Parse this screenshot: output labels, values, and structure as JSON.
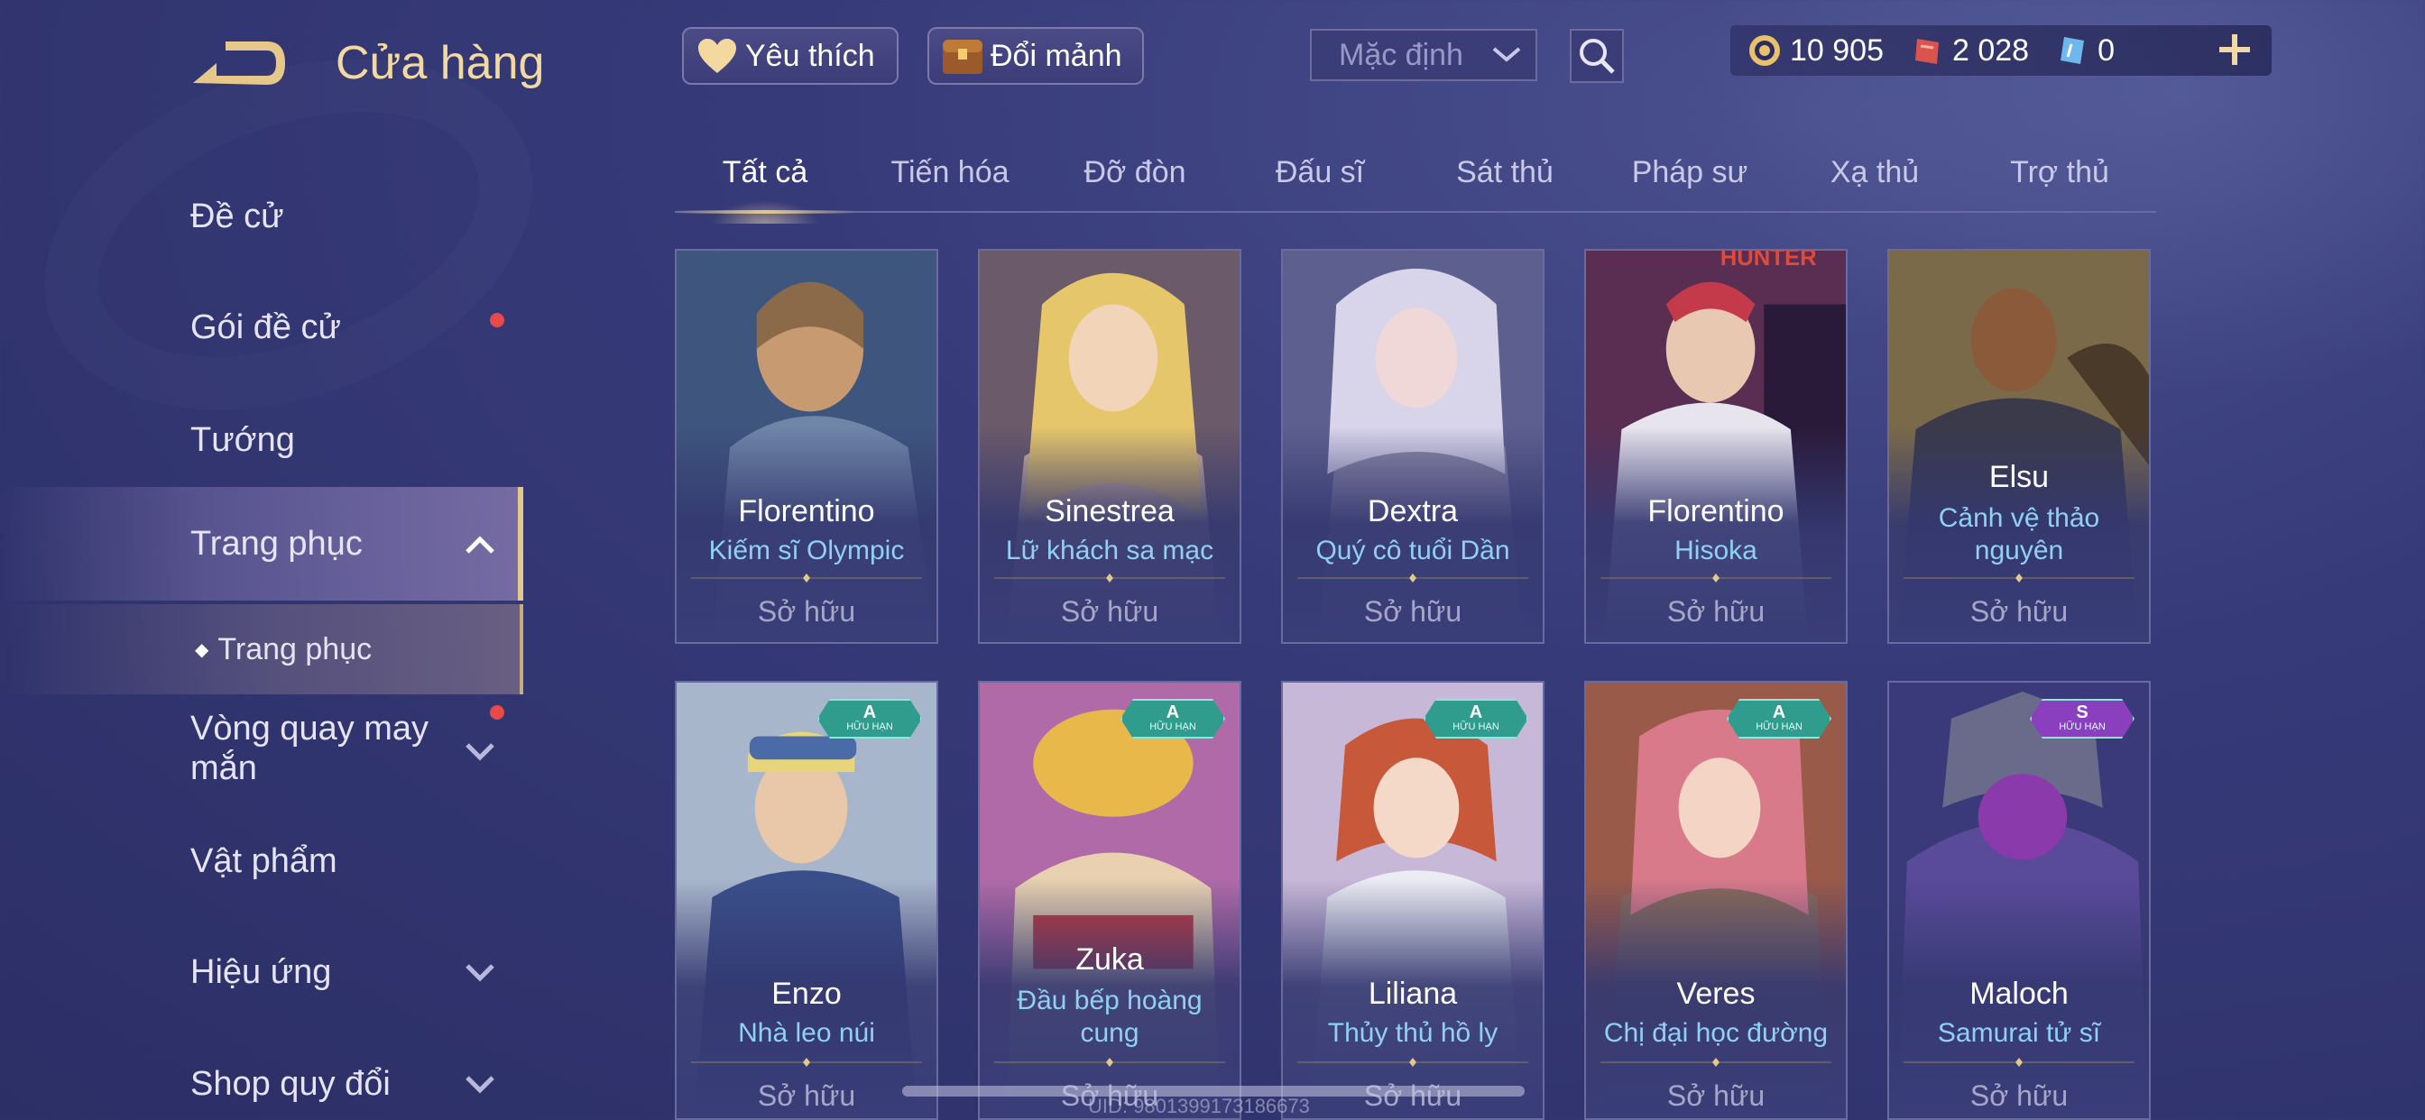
{
  "header": {
    "title": "Cửa hàng",
    "favorites_label": "Yêu thích",
    "exchange_label": "Đổi mảnh",
    "sort_value": "Mặc định",
    "currencies": [
      {
        "icon": "gold-coin-icon",
        "value": "10 905"
      },
      {
        "icon": "red-voucher-icon",
        "value": "2 028"
      },
      {
        "icon": "blue-voucher-icon",
        "value": "0"
      }
    ]
  },
  "sidebar": {
    "items": [
      {
        "label": "Đề cử",
        "has_dot": false
      },
      {
        "label": "Gói đề cử",
        "has_dot": true
      },
      {
        "label": "Tướng"
      },
      {
        "label": "Trang phục",
        "expanded": true
      },
      {
        "label": "Trang phục",
        "sub": true
      },
      {
        "label": "Vòng quay may mắn",
        "has_dot": true
      },
      {
        "label": "Vật phẩm"
      },
      {
        "label": "Hiệu ứng"
      },
      {
        "label": "Shop quy đổi"
      }
    ]
  },
  "tabs": [
    "Tất cả",
    "Tiến hóa",
    "Đỡ đòn",
    "Đấu sĩ",
    "Sát thủ",
    "Pháp sư",
    "Xạ thủ",
    "Trợ thủ"
  ],
  "active_tab": "Tất cả",
  "cards": [
    {
      "hero": "Florentino",
      "skin": "Kiếm sĩ Olympic",
      "status": "Sở hữu"
    },
    {
      "hero": "Sinestrea",
      "skin": "Lữ khách sa mạc",
      "status": "Sở hữu"
    },
    {
      "hero": "Dextra",
      "skin": "Quý cô tuổi Dần",
      "status": "Sở hữu"
    },
    {
      "hero": "Florentino",
      "skin": "Hisoka",
      "status": "Sở hữu",
      "art_text": "HUNTER"
    },
    {
      "hero": "Elsu",
      "skin": "Cảnh vệ thảo nguyên",
      "status": "Sở hữu"
    },
    {
      "hero": "Enzo",
      "skin": "Nhà leo núi",
      "status": "Sở hữu",
      "badge": {
        "tier": "A",
        "label": "HỮU HẠN"
      }
    },
    {
      "hero": "Zuka",
      "skin": "Đầu bếp hoàng cung",
      "status": "Sở hữu",
      "badge": {
        "tier": "A",
        "label": "HỮU HẠN"
      }
    },
    {
      "hero": "Liliana",
      "skin": "Thủy thủ hồ ly",
      "status": "Sở hữu",
      "badge": {
        "tier": "A",
        "label": "HỮU HẠN"
      }
    },
    {
      "hero": "Veres",
      "skin": "Chị đại học đường",
      "status": "Sở hữu",
      "badge": {
        "tier": "A",
        "label": "HỮU HẠN"
      }
    },
    {
      "hero": "Maloch",
      "skin": "Samurai tử sĩ",
      "status": "Sở hữu",
      "badge": {
        "tier": "S",
        "label": "HỮU HẠN"
      }
    }
  ],
  "footer": {
    "uid": "UID: 9801399173186673"
  },
  "colors": {
    "accent_gold": "#e2c98a",
    "skin_name_blue": "#8fd0f4",
    "notification_red": "#e84a4a"
  }
}
